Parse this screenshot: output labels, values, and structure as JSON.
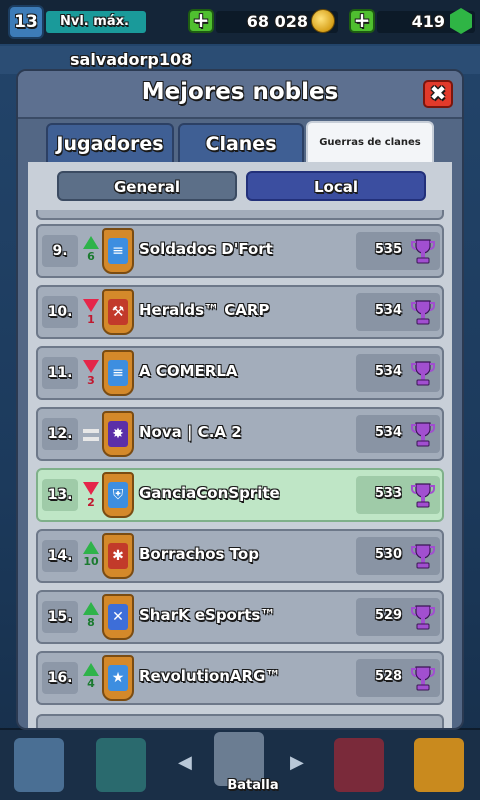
{
  "topbar": {
    "level": "13",
    "level_label": "Nvl. máx.",
    "gold": "68 028",
    "gems": "419",
    "plus_label": "+"
  },
  "player": {
    "name": "salvadorp108"
  },
  "modal": {
    "title": "Mejores nobles",
    "close_label": "✖",
    "tabs": [
      {
        "label": "Jugadores",
        "active": false
      },
      {
        "label": "Clanes",
        "active": false
      },
      {
        "label": "Guerras de clanes",
        "active": true
      }
    ],
    "filters": [
      {
        "label": "General",
        "active": false
      },
      {
        "label": "Local",
        "active": true
      }
    ]
  },
  "clans": [
    {
      "rank": "9.",
      "trend": "up",
      "change": "6",
      "name": "Soldados D'Fort",
      "score": "535",
      "badge_color": "#3d8ee0",
      "badge_icon": "bars-icon"
    },
    {
      "rank": "10.",
      "trend": "down",
      "change": "1",
      "name": "Heralds™ CARP",
      "score": "534",
      "badge_color": "#c23a2a",
      "badge_icon": "hammer-icon"
    },
    {
      "rank": "11.",
      "trend": "down",
      "change": "3",
      "name": "A COMERLA",
      "score": "534",
      "badge_color": "#3d8ee0",
      "badge_icon": "bars-icon"
    },
    {
      "rank": "12.",
      "trend": "same",
      "change": "",
      "name": "Nova | C.A 2",
      "score": "534",
      "badge_color": "#5b2fa8",
      "badge_icon": "star-burst-icon"
    },
    {
      "rank": "13.",
      "trend": "down",
      "change": "2",
      "name": "GanciaConSprite",
      "score": "533",
      "badge_color": "#3d8ee0",
      "badge_icon": "shield-icon",
      "highlight": true
    },
    {
      "rank": "14.",
      "trend": "up",
      "change": "10",
      "name": "Borrachos Top",
      "score": "530",
      "badge_color": "#c23a2a",
      "badge_icon": "snowflake-icon"
    },
    {
      "rank": "15.",
      "trend": "up",
      "change": "8",
      "name": "SharK eSports™",
      "score": "529",
      "badge_color": "#3d6ed8",
      "badge_icon": "cross-swords-icon"
    },
    {
      "rank": "16.",
      "trend": "up",
      "change": "4",
      "name": "RevolutionARG™",
      "score": "528",
      "badge_color": "#3d8ee0",
      "badge_icon": "star-icon"
    }
  ],
  "bottom_nav": {
    "battle_label": "Batalla"
  },
  "colors": {
    "trophy": "#a14fd0",
    "up": "#2eb34a",
    "down": "#e5264a",
    "highlight_row": "#bfe6c6"
  }
}
